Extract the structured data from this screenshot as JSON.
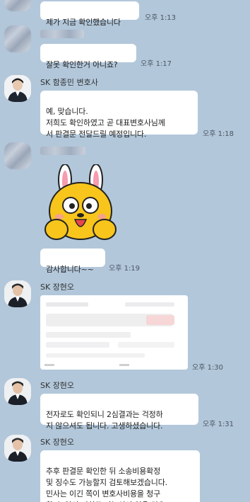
{
  "messages": {
    "m1_text": "제가 지금 확인했습니다",
    "m1_time": "오후 1:13",
    "m2_text": "잘못 확인한거 아니죠?",
    "m2_time": "오후 1:17",
    "m3_sender": "SK 함종민 변호사",
    "m3_text": "예, 맞습니다.\n저희도 확인하였고 곧 대표변호사님께\n서 판결문 전달드릴 예정입니다.",
    "m3_time": "오후 1:18",
    "m4_text": "감사합니다~~",
    "m4_time": "오후 1:19",
    "m5_sender": "SK 장현오",
    "m5_time": "오후 1:30",
    "m6_sender": "SK 장현오",
    "m6_text": "전자로도 확인되니 2심결과는 걱정하\n지 않으셔도 됩니다. 고생하셨습니다.",
    "m6_time": "오후 1:31",
    "m7_sender": "SK 장현오",
    "m7_text": "추후 판결문 확인한 뒤 소송비용확정\n및 징수도 가능할지 검토해보겠습니다.\n 민사는 이긴 쪽이 변호사비용을 청구\n할 수 있어 저희도 가능성이 있을 것으"
  },
  "colors": {
    "chat_background": "#b2c7da",
    "bubble": "#ffffff",
    "sticker_yellow": "#f7c51b"
  },
  "icons": {
    "sticker": "rabbit-ears-character-sticker",
    "avatar": "lawyer-profile-photo"
  }
}
